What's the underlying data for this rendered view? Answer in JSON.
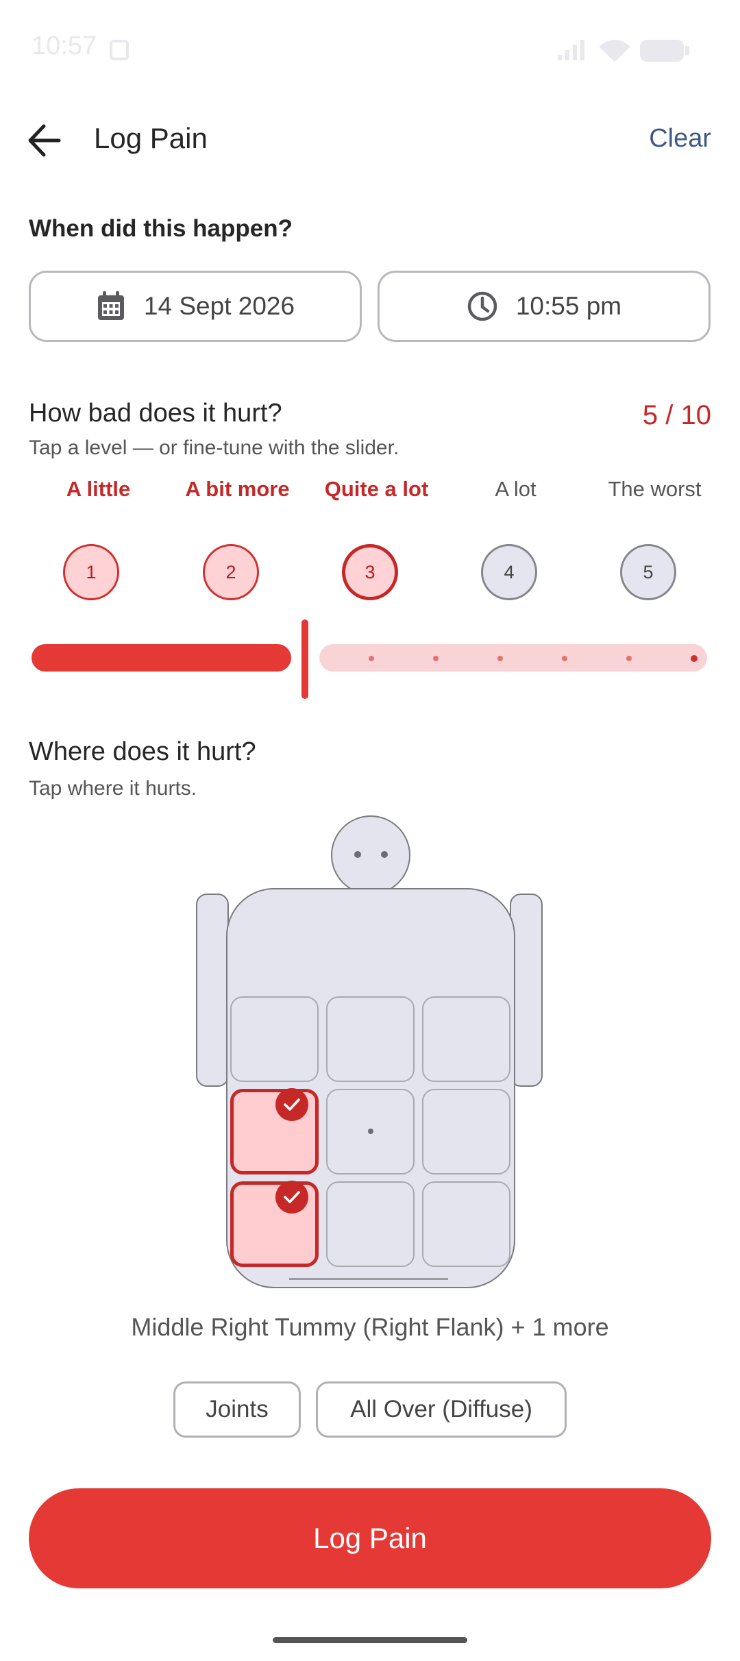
{
  "status": {
    "time": "10:57"
  },
  "appbar": {
    "title": "Log Pain",
    "clear_label": "Clear"
  },
  "when": {
    "question": "When did this happen?",
    "date": "14 Sept 2026",
    "time": "10:55 pm"
  },
  "severity": {
    "question": "How bad does it hurt?",
    "hint": "Tap a level — or fine-tune with the slider.",
    "score": "5 / 10",
    "slider_value": 5,
    "slider_max": 10,
    "levels": [
      {
        "label": "A little",
        "number": "1",
        "state": "on"
      },
      {
        "label": "A bit more",
        "number": "2",
        "state": "on"
      },
      {
        "label": "Quite a lot",
        "number": "3",
        "state": "selected"
      },
      {
        "label": "A lot",
        "number": "4",
        "state": "off"
      },
      {
        "label": "The worst",
        "number": "5",
        "state": "off"
      }
    ]
  },
  "location": {
    "question": "Where does it hurt?",
    "hint": "Tap where it hurts.",
    "summary": "Middle Right Tummy (Right Flank) + 1 more",
    "chips": [
      "Joints",
      "All Over (Diffuse)"
    ]
  },
  "cta": {
    "label": "Log Pain"
  },
  "colors": {
    "accent": "#e53935",
    "selected_text": "#c62828",
    "link": "#3f5a86",
    "body_fill": "#e3e4ee"
  }
}
